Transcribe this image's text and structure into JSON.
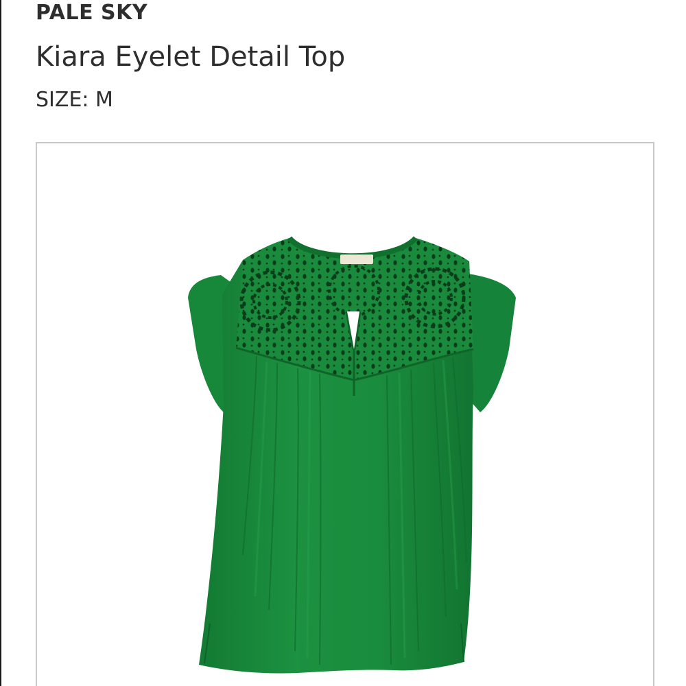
{
  "product": {
    "brand": "PALE SKY",
    "name": "Kiara Eyelet Detail Top",
    "size": "SIZE: M",
    "image": {
      "icon": "green-eyelet-top-photo",
      "color": "#1e8a3e"
    }
  }
}
